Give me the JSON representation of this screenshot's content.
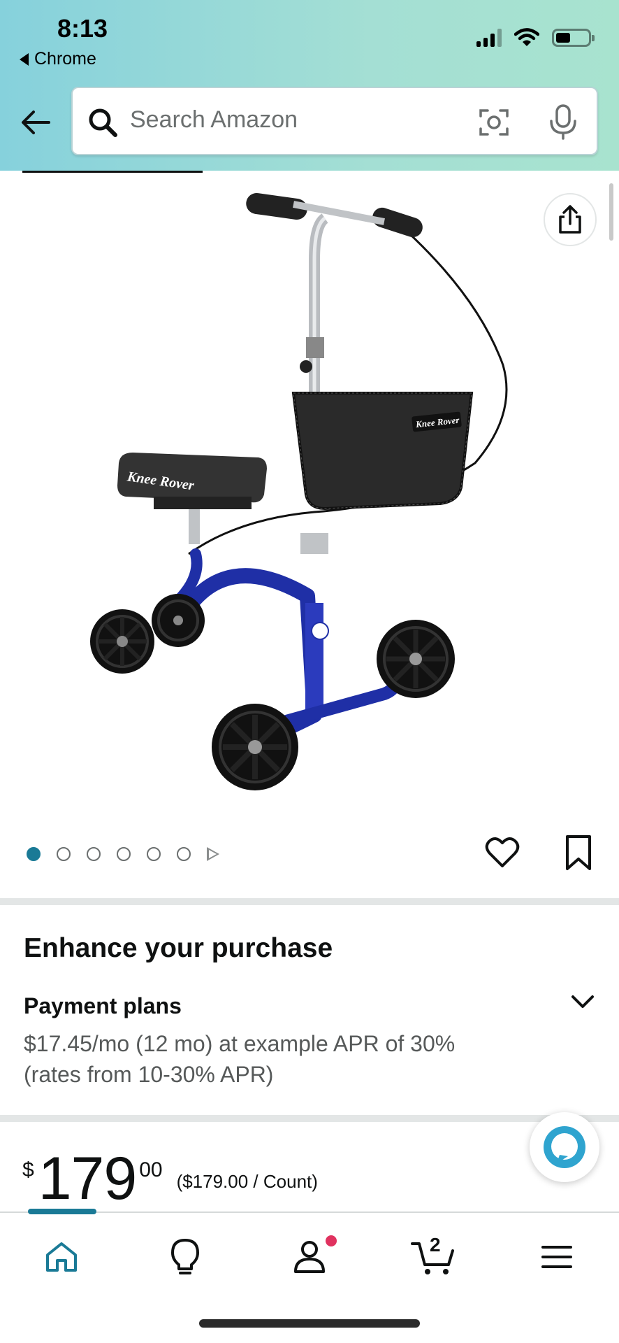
{
  "status_bar": {
    "time": "8:13",
    "back_app": "Chrome"
  },
  "search": {
    "placeholder": "Search Amazon"
  },
  "image": {
    "brand_text": "Knee Rover",
    "dots_total": 6,
    "dots_active": 1
  },
  "enhance": {
    "title": "Enhance your purchase",
    "payment_title": "Payment plans",
    "payment_desc": "$17.45/mo (12 mo) at example APR of 30% (rates from 10-30% APR)"
  },
  "price": {
    "symbol": "$",
    "whole": "179",
    "fraction": "00",
    "unit_price": "($179.00 / Count)"
  },
  "nav": {
    "cart_count": "2"
  },
  "colors": {
    "accent": "#1a7a96",
    "header_start": "#86d1dc",
    "header_end": "#a8e3cf",
    "badge": "#e0325f",
    "frame_blue": "#1f2fa6"
  }
}
